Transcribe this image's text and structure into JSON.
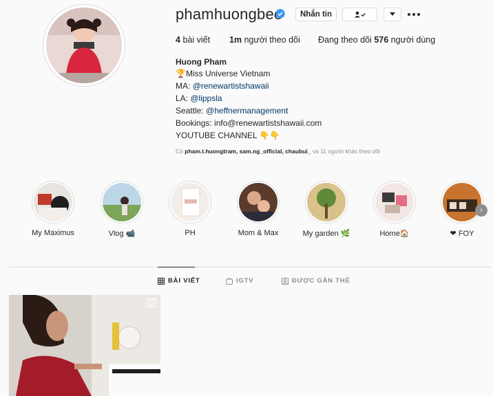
{
  "profile": {
    "username": "phamhuongbee",
    "message_label": "Nhắn tin",
    "stats": {
      "posts": "4",
      "posts_label": "bài viết",
      "followers": "1m",
      "followers_label": "người theo dõi",
      "following_prefix": "Đang theo dõi",
      "following": "576",
      "following_suffix": "người dùng"
    },
    "full_name": "Huong Pham",
    "bio": {
      "line1": "🏆Miss Universe Vietnam",
      "ma_prefix": "MA:",
      "ma_link": "@renewartistshawaii",
      "la_prefix": "LA:",
      "la_link": "@lippsla",
      "seattle_prefix": "Seattle:",
      "seattle_link": "@heffnermanagement",
      "bookings": "Bookings: info@renewartistshawaii.com",
      "youtube": "YOUTUBE CHANNEL 👇👇"
    },
    "followed_by": {
      "prefix": "Có",
      "users": "pham.t.huongtram, sam.ng_official, chaubui_",
      "suffix": "và 11 người khác theo dõi"
    }
  },
  "highlights": [
    {
      "label": "My Maximus"
    },
    {
      "label": "Vlog 📹"
    },
    {
      "label": "PH"
    },
    {
      "label": "Mom & Max"
    },
    {
      "label": "My garden 🌿"
    },
    {
      "label": "Home🏠"
    },
    {
      "label": "❤ FOY"
    }
  ],
  "tabs": [
    {
      "label": "BÀI VIẾT",
      "icon": "grid-icon",
      "active": true
    },
    {
      "label": "IGTV",
      "icon": "igtv-icon",
      "active": false
    },
    {
      "label": "ĐƯỢC GẮN THẺ",
      "icon": "tagged-icon",
      "active": false
    }
  ],
  "colors": {
    "link": "#00376b",
    "verified": "#3897f0",
    "muted": "#8e8e8e",
    "border": "#dbdbdb"
  }
}
